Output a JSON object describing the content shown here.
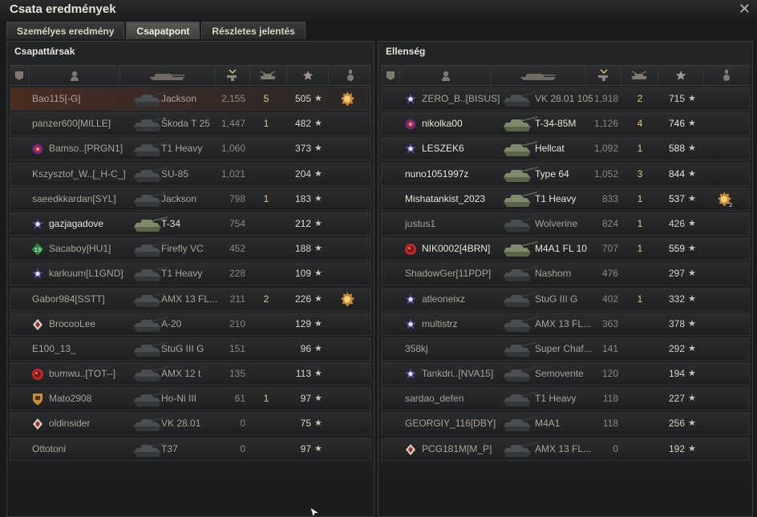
{
  "window": {
    "title": "Csata eredmények"
  },
  "tabs": [
    {
      "label": "Személyes eredmény",
      "active": false
    },
    {
      "label": "Csapatpont",
      "active": true
    },
    {
      "label": "Részletes jelentés",
      "active": false
    }
  ],
  "left": {
    "title": "Csapattársak",
    "rows": [
      {
        "player": "Bao115[-G]",
        "tank": "Jackson",
        "damage": "2,155",
        "kills": "5",
        "xp": "505",
        "badge": "",
        "medal": "hero-medal",
        "highlight": true,
        "alive": false
      },
      {
        "player": "panzer600[MILLE]",
        "tank": "Škoda T 25",
        "damage": "1,447",
        "kills": "1",
        "xp": "482",
        "badge": "",
        "medal": "",
        "highlight": false,
        "alive": false
      },
      {
        "player": "Bamso..[PRGN1]",
        "tank": "T1 Heavy",
        "damage": "1,060",
        "kills": "",
        "xp": "373",
        "badge": "clan-red",
        "medal": "",
        "highlight": false,
        "alive": false
      },
      {
        "player": "Kszysztof_W..[_H-C_]",
        "tank": "SU-85",
        "damage": "1,021",
        "kills": "",
        "xp": "204",
        "badge": "",
        "medal": "",
        "highlight": false,
        "alive": false
      },
      {
        "player": "saeedkkardan[SYL]",
        "tank": "Jackson",
        "damage": "798",
        "kills": "1",
        "xp": "183",
        "badge": "",
        "medal": "",
        "highlight": false,
        "alive": false
      },
      {
        "player": "gazjagadove",
        "tank": "T-34",
        "damage": "754",
        "kills": "",
        "xp": "212",
        "badge": "clan-star",
        "medal": "",
        "highlight": false,
        "alive": true
      },
      {
        "player": "Sacaboy[HU1]",
        "tank": "Firefly VC",
        "damage": "452",
        "kills": "",
        "xp": "188",
        "badge": "rank-13",
        "medal": "",
        "highlight": false,
        "alive": false
      },
      {
        "player": "karkuum[L1GND]",
        "tank": "T1 Heavy",
        "damage": "228",
        "kills": "",
        "xp": "109",
        "badge": "clan-star",
        "medal": "",
        "highlight": false,
        "alive": false
      },
      {
        "player": "Gabor984[SSTT]",
        "tank": "AMX 13 FL...",
        "damage": "211",
        "kills": "2",
        "xp": "226",
        "badge": "",
        "medal": "hero-medal",
        "highlight": false,
        "alive": false
      },
      {
        "player": "BrocooLee",
        "tank": "A-20",
        "damage": "210",
        "kills": "",
        "xp": "129",
        "badge": "clan-diamond",
        "medal": "",
        "highlight": false,
        "alive": false
      },
      {
        "player": "E100_13_",
        "tank": "StuG III G",
        "damage": "151",
        "kills": "",
        "xp": "96",
        "badge": "",
        "medal": "",
        "highlight": false,
        "alive": false
      },
      {
        "player": "bumwu..[TOT--]",
        "tank": "AMX 12 t",
        "damage": "135",
        "kills": "",
        "xp": "113",
        "badge": "clan-redball",
        "medal": "",
        "highlight": false,
        "alive": false
      },
      {
        "player": "Mato2908",
        "tank": "Ho-Ni III",
        "damage": "61",
        "kills": "1",
        "xp": "97",
        "badge": "clan-shield",
        "medal": "",
        "highlight": false,
        "alive": false
      },
      {
        "player": "oldinsider",
        "tank": "VK 28.01",
        "damage": "0",
        "kills": "",
        "xp": "75",
        "badge": "clan-diamond",
        "medal": "",
        "highlight": false,
        "alive": false
      },
      {
        "player": "Ottotoni",
        "tank": "T37",
        "damage": "0",
        "kills": "",
        "xp": "97",
        "badge": "",
        "medal": "",
        "highlight": false,
        "alive": false
      }
    ]
  },
  "right": {
    "title": "Ellenség",
    "rows": [
      {
        "player": "ZERO_B..[BISUS]",
        "tank": "VK 28.01 105",
        "damage": "1,918",
        "kills": "2",
        "xp": "715",
        "badge": "clan-star",
        "medal": "",
        "alive": false
      },
      {
        "player": "nikolka00",
        "tank": "T-34-85M",
        "damage": "1,126",
        "kills": "4",
        "xp": "746",
        "badge": "clan-red",
        "medal": "",
        "alive": true
      },
      {
        "player": "LESZEK6",
        "tank": "Hellcat",
        "damage": "1,092",
        "kills": "1",
        "xp": "588",
        "badge": "clan-star",
        "medal": "",
        "alive": true
      },
      {
        "player": "nuno1051997z",
        "tank": "Type 64",
        "damage": "1,052",
        "kills": "3",
        "xp": "844",
        "badge": "",
        "medal": "",
        "alive": true
      },
      {
        "player": "Mishatankist_2023",
        "tank": "T1 Heavy",
        "damage": "833",
        "kills": "1",
        "xp": "537",
        "badge": "",
        "medal": "hero-medal-2",
        "medal_count": "2",
        "alive": true
      },
      {
        "player": "justus1",
        "tank": "Wolverine",
        "damage": "824",
        "kills": "1",
        "xp": "426",
        "badge": "",
        "medal": "",
        "alive": false
      },
      {
        "player": "NIK0002[4BRN]",
        "tank": "M4A1 FL 10",
        "damage": "707",
        "kills": "1",
        "xp": "559",
        "badge": "clan-redball",
        "medal": "",
        "alive": true
      },
      {
        "player": "ShadowGer[11PDP]",
        "tank": "Nashorn",
        "damage": "476",
        "kills": "",
        "xp": "297",
        "badge": "",
        "medal": "",
        "alive": false
      },
      {
        "player": "atleoneixz",
        "tank": "StuG III G",
        "damage": "402",
        "kills": "1",
        "xp": "332",
        "badge": "clan-star",
        "medal": "",
        "alive": false
      },
      {
        "player": "multistrz",
        "tank": "AMX 13 FL...",
        "damage": "363",
        "kills": "",
        "xp": "378",
        "badge": "clan-star",
        "medal": "",
        "alive": false
      },
      {
        "player": "358kj",
        "tank": "Super Chaf...",
        "damage": "141",
        "kills": "",
        "xp": "292",
        "badge": "",
        "medal": "",
        "alive": false
      },
      {
        "player": "Tankdri..[NVA15]",
        "tank": "Semovente",
        "damage": "120",
        "kills": "",
        "xp": "194",
        "badge": "clan-star",
        "medal": "",
        "alive": false
      },
      {
        "player": "sardao_defen",
        "tank": "T1 Heavy",
        "damage": "118",
        "kills": "",
        "xp": "227",
        "badge": "",
        "medal": "",
        "alive": false
      },
      {
        "player": "GEORGIY_116[DBY]",
        "tank": "M4A1",
        "damage": "118",
        "kills": "",
        "xp": "256",
        "badge": "",
        "medal": "",
        "alive": false
      },
      {
        "player": "PCG181M[M_P]",
        "tank": "AMX 13 FL...",
        "damage": "0",
        "kills": "",
        "xp": "192",
        "badge": "clan-diamond",
        "medal": "",
        "alive": false
      }
    ]
  },
  "colors": {
    "accent": "#e0c880",
    "player_row": "#4a2c22"
  }
}
